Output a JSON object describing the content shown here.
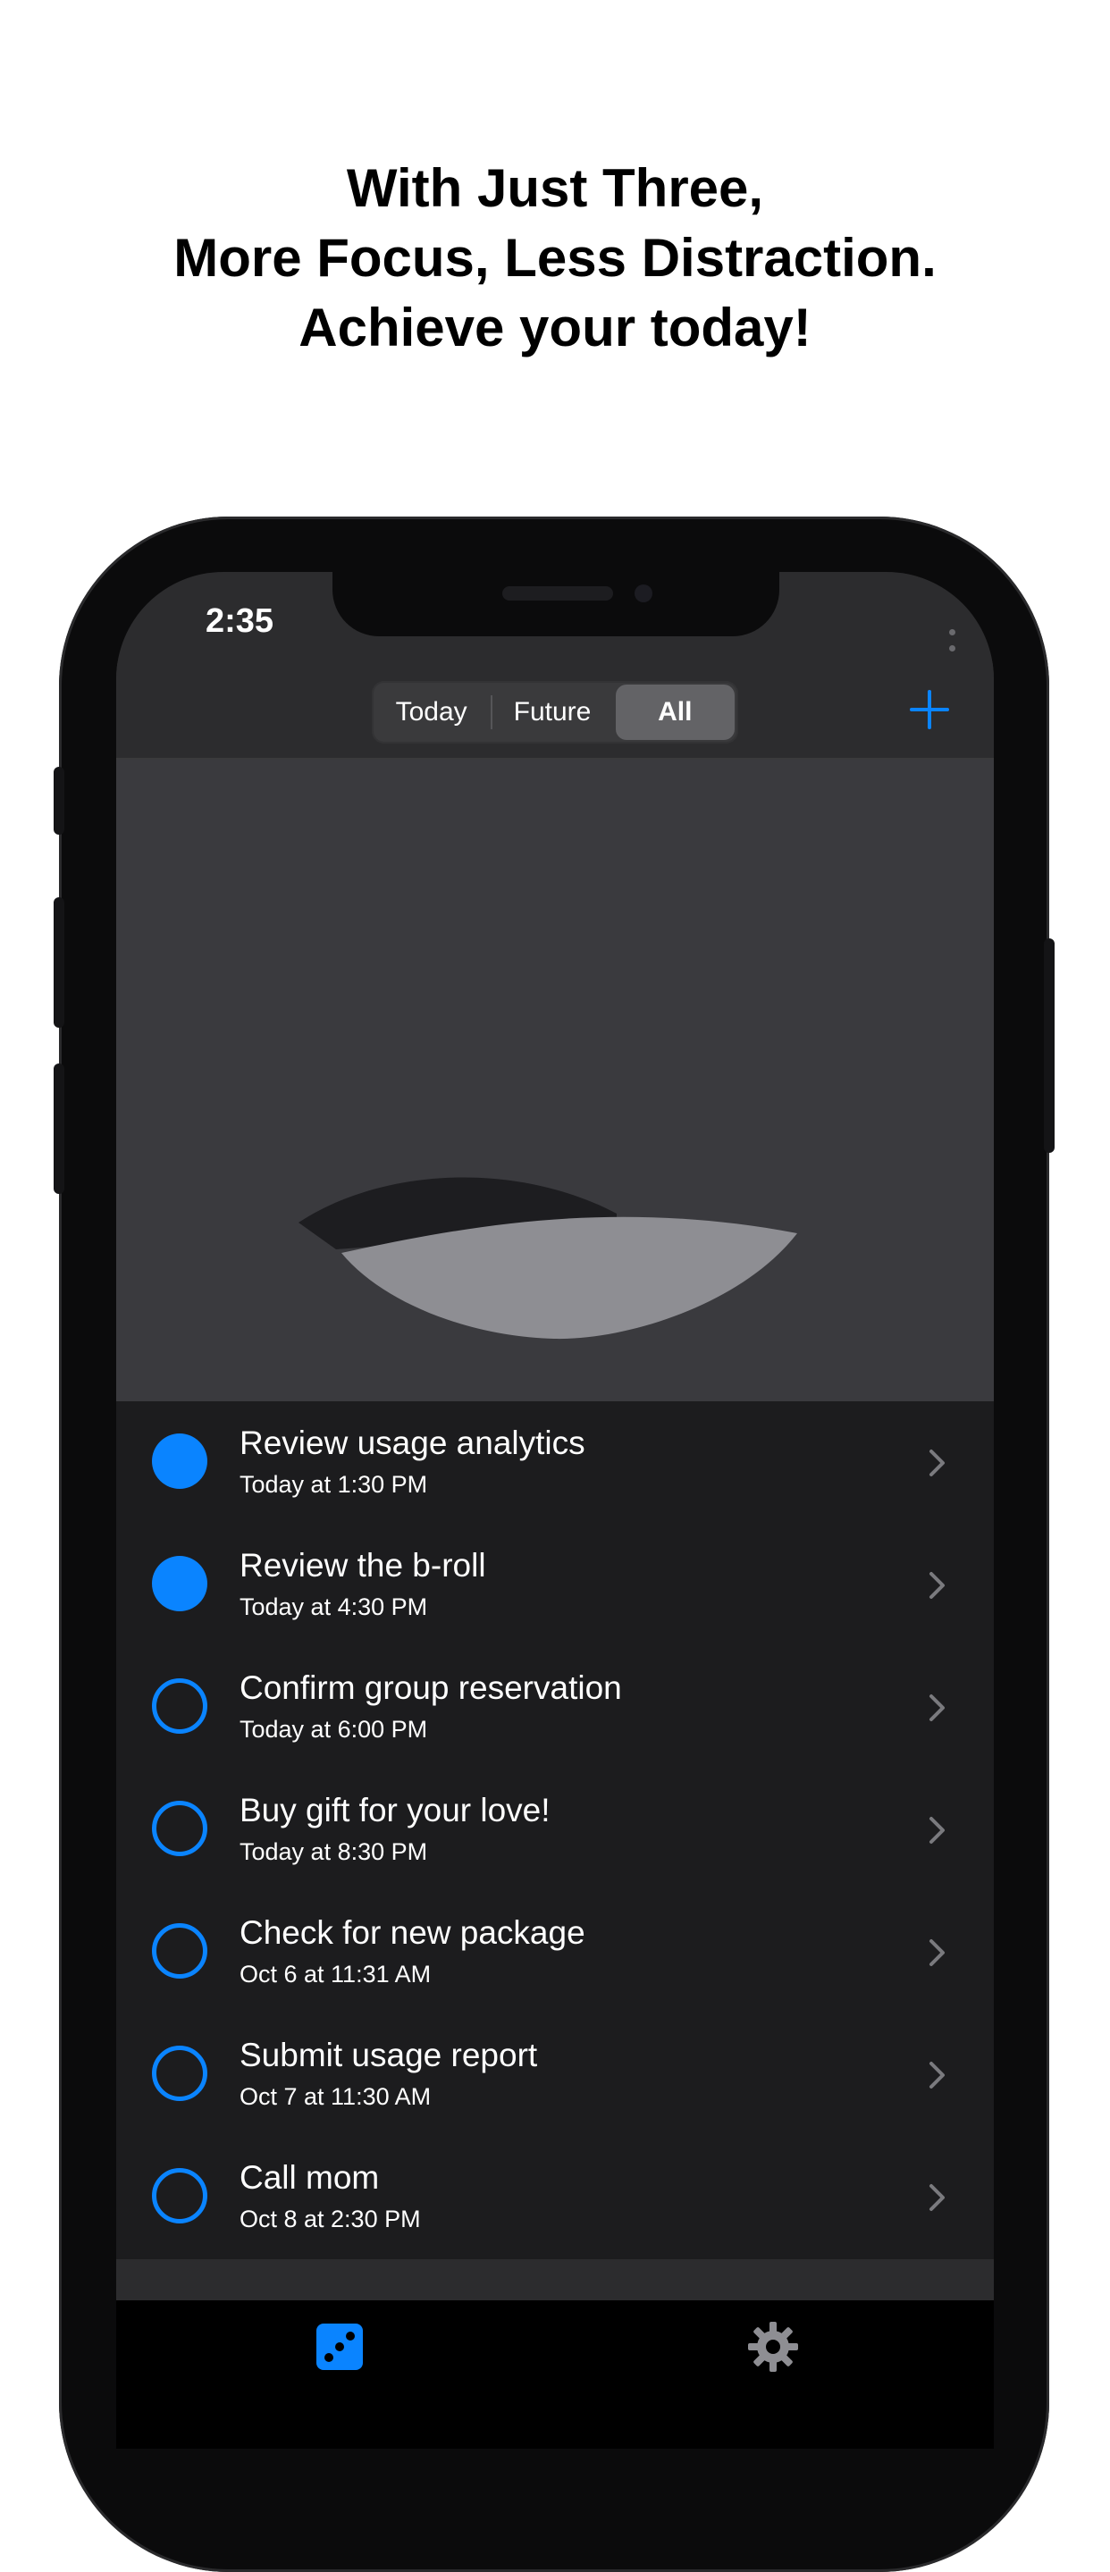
{
  "headline": {
    "line1": "With Just Three,",
    "line2": "More Focus, Less Distraction.",
    "line3": "Achieve your today!"
  },
  "status_bar": {
    "time": "2:35",
    "icons": [
      "signal-dots-icon",
      "wifi-icon",
      "battery-icon"
    ]
  },
  "navbar": {
    "segments": [
      "Today",
      "Future",
      "All"
    ],
    "selected_segment": "All",
    "add_icon": "plus-icon"
  },
  "tasks": [
    {
      "title": "Review usage analytics",
      "time": "Today at 1:30 PM",
      "done": true
    },
    {
      "title": "Review the b-roll",
      "time": "Today at 4:30 PM",
      "done": true
    },
    {
      "title": "Confirm group reservation",
      "time": "Today at 6:00 PM",
      "done": false
    },
    {
      "title": "Buy gift for your love!",
      "time": "Today at 8:30 PM",
      "done": false
    },
    {
      "title": "Check for new package",
      "time": "Oct 6 at 11:31 AM",
      "done": false
    },
    {
      "title": "Submit usage report",
      "time": "Oct 7 at 11:30 AM",
      "done": false
    },
    {
      "title": "Call mom",
      "time": "Oct 8 at 2:30 PM",
      "done": false
    }
  ],
  "tabbar": {
    "tabs": [
      {
        "icon": "dice-icon",
        "active": true
      },
      {
        "icon": "gear-icon",
        "active": false
      }
    ]
  },
  "colors": {
    "accent": "#0a84ff",
    "background": "#1c1c1e",
    "navbar": "#2c2c2e",
    "hero": "#3a3a3e"
  }
}
